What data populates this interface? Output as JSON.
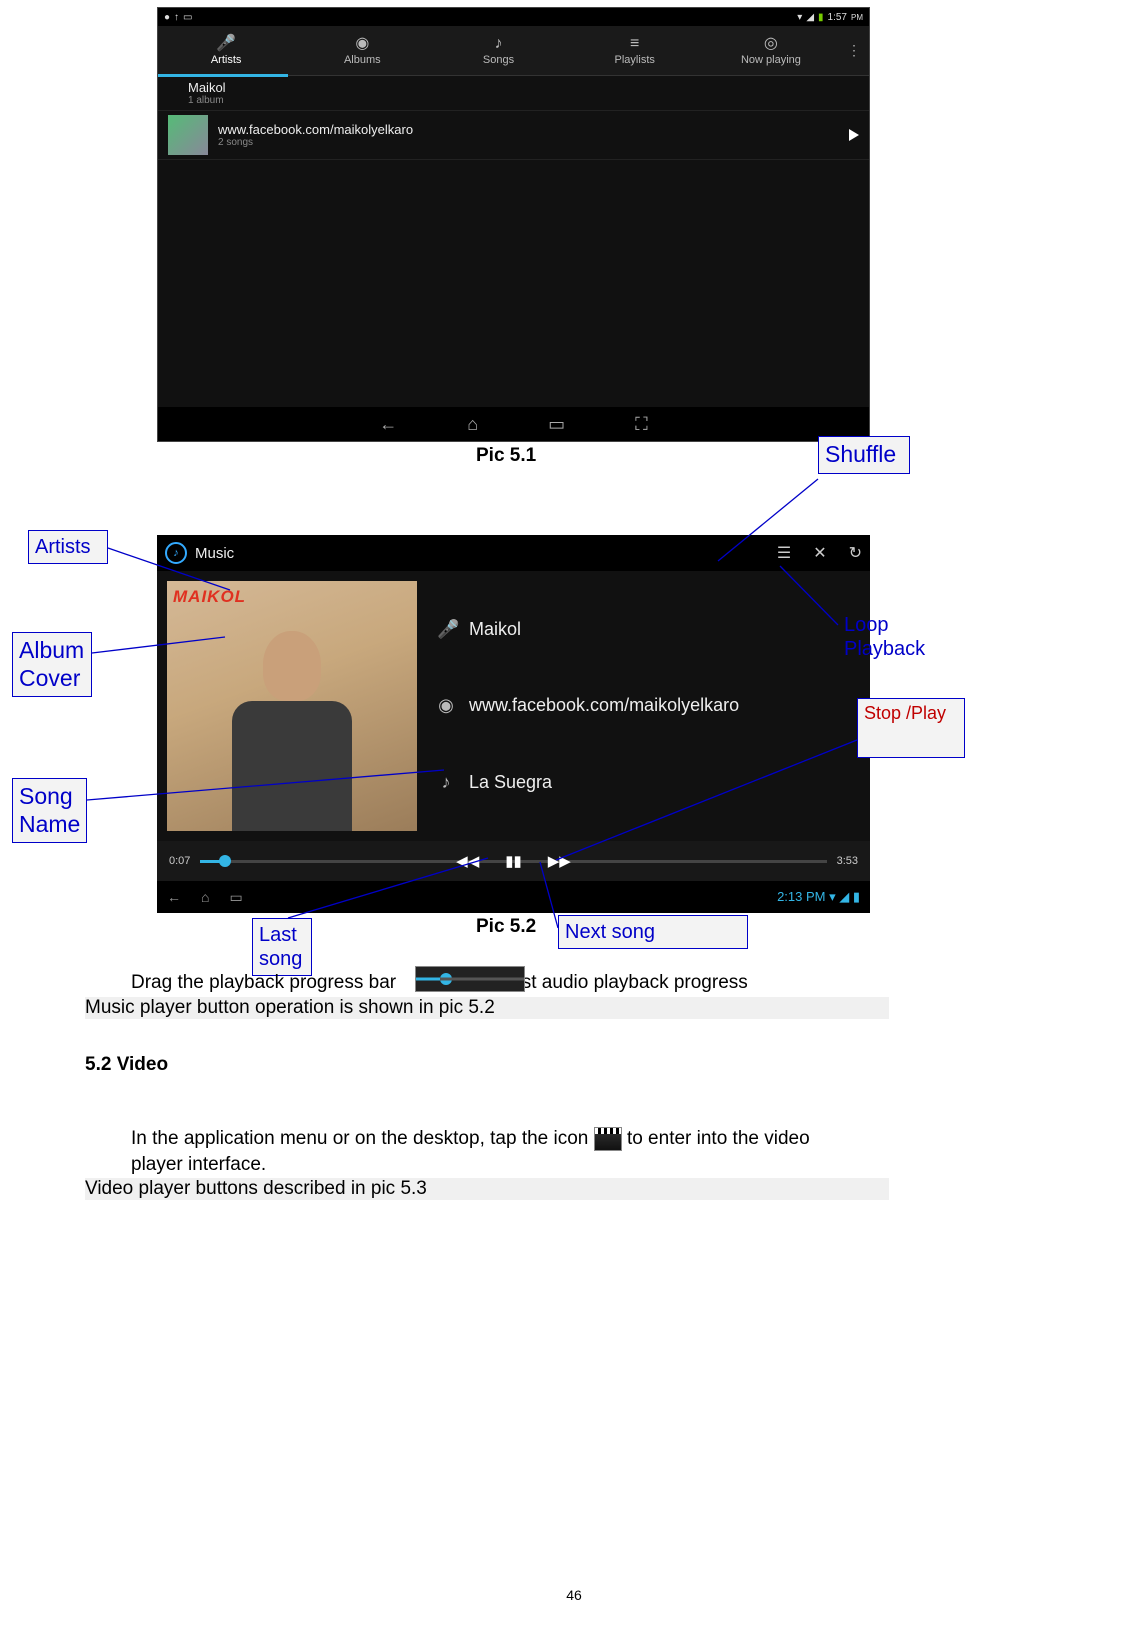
{
  "captions": {
    "pic51": "Pic 5.1",
    "pic52": "Pic 5.2"
  },
  "screenshot1": {
    "status_time": "1:57",
    "tabs": {
      "artists": "Artists",
      "albums": "Albums",
      "songs": "Songs",
      "playlists": "Playlists",
      "now_playing": "Now playing"
    },
    "row1": {
      "title": "Maikol",
      "sub": "1 album"
    },
    "row2": {
      "title": "www.facebook.com/maikolyelkaro",
      "sub": "2 songs"
    }
  },
  "screenshot2": {
    "app_title": "Music",
    "cover_label": "MAIKOL",
    "artist": "Maikol",
    "album": "www.facebook.com/maikolyelkaro",
    "song": "La Suegra",
    "elapsed": "0:07",
    "duration": "3:53",
    "clock": "2:13"
  },
  "callouts": {
    "shuffle": "Shuffle",
    "artists": "Artists",
    "album_cover_l1": "Album",
    "album_cover_l2": "Cover",
    "song_name_l1": "Song",
    "song_name_l2": "Name",
    "loop_l1": "Loop",
    "loop_l2": "Playback",
    "stop_play": "Stop /Play",
    "last_song_l1": "Last",
    "last_song_l2": "song",
    "next_song": "Next song"
  },
  "body": {
    "drag_line": "Drag the playback progress bar             to adjust audio playback progress",
    "music_button_line": "Music player button operation is shown in pic 5.2",
    "section_video": "5.2 Video",
    "video_line1a": "In the application menu or on the desktop, tap the icon ",
    "video_line1b": " to enter into the video",
    "video_line2": "player interface.",
    "video_button_line": "Video player buttons described in pic 5.3"
  },
  "page_number": "46"
}
